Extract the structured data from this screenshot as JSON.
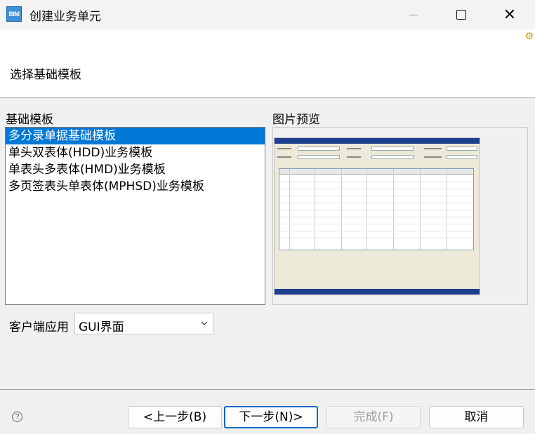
{
  "window": {
    "icon_text": "BIM",
    "title": "创建业务单元",
    "minimize_icon": "minimize-icon",
    "maximize_icon": "maximize-icon",
    "close_icon": "close-icon",
    "close_glyph": "✕"
  },
  "header": {
    "title": "选择基础模板",
    "decoration_icon": "wizard-icon",
    "decoration_glyph": "⚙"
  },
  "templates": {
    "label": "基础模板",
    "selected_index": 0,
    "items": [
      "多分录单据基础模板",
      "单头双表体(HDD)业务模板",
      "单表头多表体(HMD)业务模板",
      "多页签表头单表体(MPHSD)业务模板"
    ]
  },
  "preview": {
    "label": "图片预览"
  },
  "client": {
    "label": "客户端应用",
    "selected": "GUI界面",
    "dropdown_icon": "chevron-down-icon"
  },
  "footer": {
    "help_glyph": "?",
    "back_label": "<上一步(B)",
    "next_label": "下一步(N)>",
    "finish_label": "完成(F)",
    "cancel_label": "取消"
  },
  "colors": {
    "selection": "#0078d7",
    "primary_border": "#0067c0"
  }
}
